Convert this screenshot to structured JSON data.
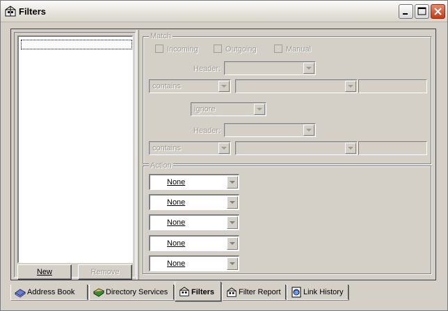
{
  "window": {
    "title": "Filters"
  },
  "filter_list": {
    "items": []
  },
  "buttons": {
    "new": "New",
    "remove": "Remove"
  },
  "match": {
    "legend": "Match",
    "incoming": "Incoming",
    "outgoing": "Outgoing",
    "manual": "Manual",
    "header1_label": "Header:",
    "header1_value": "",
    "condition1": "contains",
    "field1_value": "",
    "text1_value": "",
    "logic": "ignore",
    "header2_label": "Header:",
    "header2_value": "",
    "condition2": "contains",
    "field2_value": "",
    "text2_value": ""
  },
  "action": {
    "legend": "Action",
    "items": [
      "None",
      "None",
      "None",
      "None",
      "None"
    ]
  },
  "tabs": [
    {
      "label": "Address Book",
      "icon": "address-book-icon"
    },
    {
      "label": "Directory Services",
      "icon": "directory-services-icon"
    },
    {
      "label": "Filters",
      "icon": "filters-icon",
      "active": true
    },
    {
      "label": "Filter Report",
      "icon": "filter-report-icon"
    },
    {
      "label": "Link History",
      "icon": "link-history-icon"
    }
  ]
}
